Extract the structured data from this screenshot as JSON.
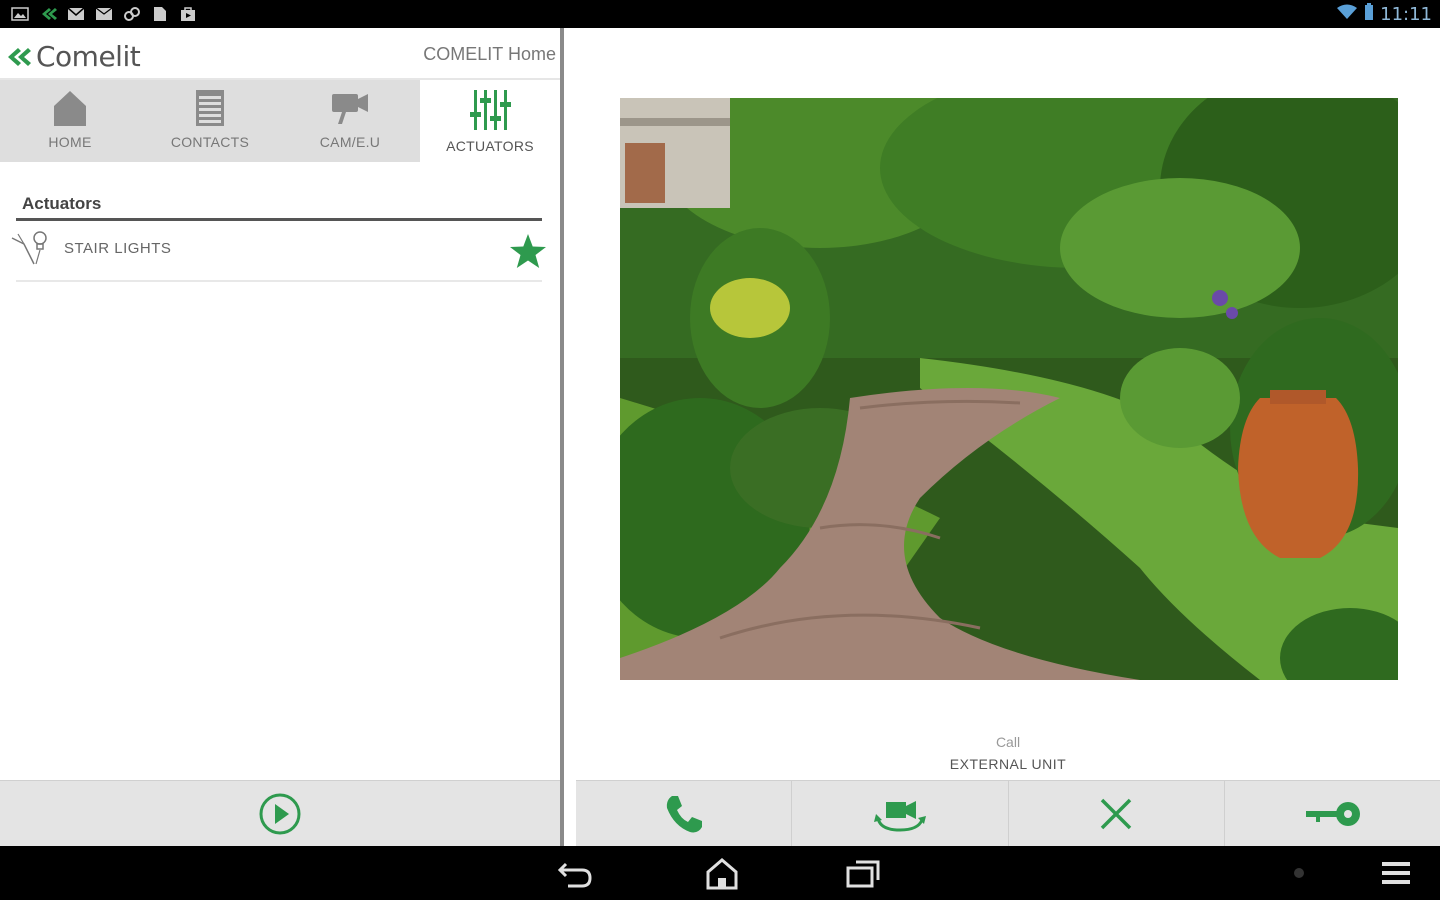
{
  "status_bar": {
    "time": "11:11",
    "left_icons": [
      "picture-icon",
      "comelit-notification-icon",
      "gmail-icon",
      "email-icon",
      "link-icon",
      "document-icon",
      "shop-bag-icon"
    ],
    "right_icons": [
      "wifi-icon",
      "battery-icon"
    ]
  },
  "header": {
    "brand": "Comelit",
    "app_title": "COMELIT Home"
  },
  "tabs": [
    {
      "label": "HOME",
      "icon": "home-icon",
      "active": false
    },
    {
      "label": "CONTACTS",
      "icon": "contacts-icon",
      "active": false
    },
    {
      "label": "CAM/E.U",
      "icon": "camera-icon",
      "active": false
    },
    {
      "label": "ACTUATORS",
      "icon": "sliders-icon",
      "active": true
    }
  ],
  "actuators": {
    "section_title": "Actuators",
    "items": [
      {
        "label": "STAIR LIGHTS",
        "icon": "light-switch-icon",
        "favorite": true
      }
    ]
  },
  "left_footer": {
    "icon": "play-icon"
  },
  "video": {
    "call_label": "Call",
    "unit_label": "EXTERNAL UNIT"
  },
  "call_controls": [
    {
      "icon": "phone-icon"
    },
    {
      "icon": "switch-camera-icon"
    },
    {
      "icon": "close-icon"
    },
    {
      "icon": "key-icon"
    }
  ],
  "nav_bar": {
    "buttons": [
      "back-icon",
      "home-nav-icon",
      "recent-apps-icon",
      "menu-icon"
    ]
  },
  "colors": {
    "accent": "#2e9a4e",
    "tabs_bg": "#dedede",
    "footer_bg": "#e4e4e4",
    "status_bar": "#000000"
  }
}
